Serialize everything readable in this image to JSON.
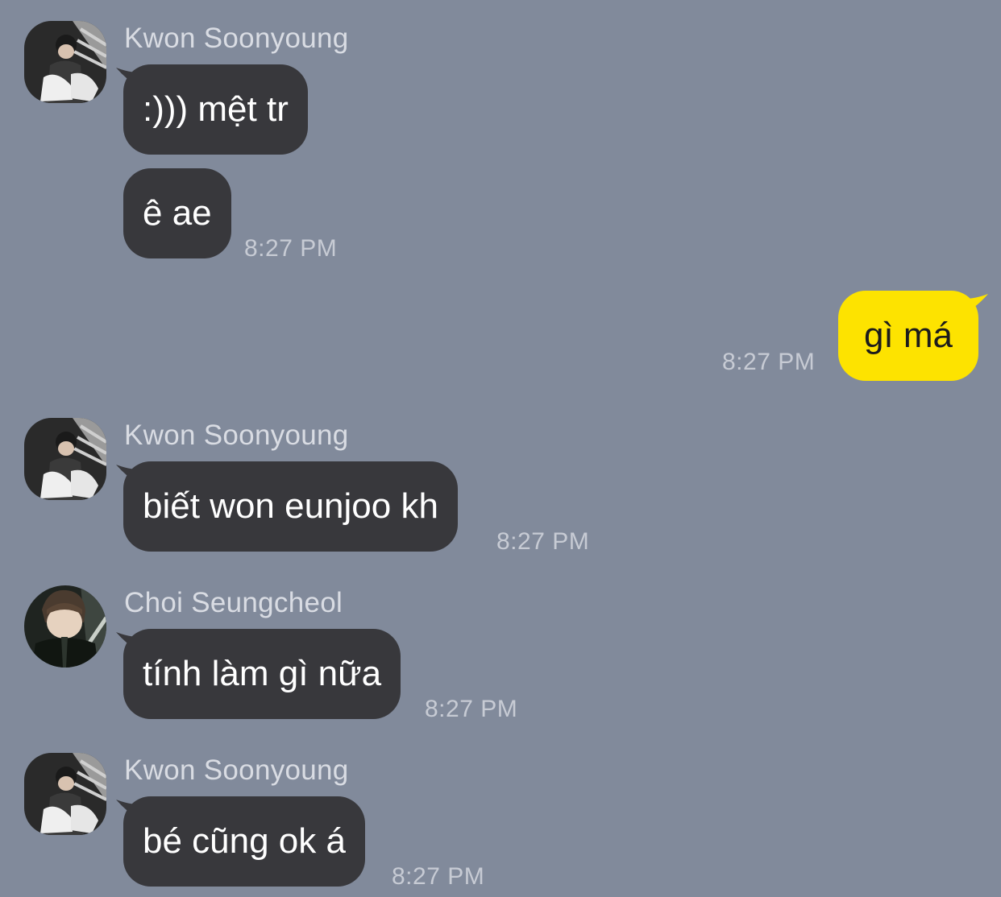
{
  "chat": {
    "colors": {
      "background": "#818a9b",
      "incoming_bubble": "#38383c",
      "outgoing_bubble": "#fde300"
    },
    "groups": [
      {
        "sender": "Kwon Soonyoung",
        "avatar": "kwon-soonyoung-avatar",
        "messages": [
          {
            "text": ":))) mệt tr"
          },
          {
            "text": "ê ae",
            "time": "8:27 PM"
          }
        ]
      },
      {
        "sender": "me",
        "messages": [
          {
            "text": "gì má",
            "time": "8:27 PM"
          }
        ]
      },
      {
        "sender": "Kwon Soonyoung",
        "avatar": "kwon-soonyoung-avatar",
        "messages": [
          {
            "text": "biết won eunjoo kh",
            "time": "8:27 PM"
          }
        ]
      },
      {
        "sender": "Choi Seungcheol",
        "avatar": "choi-seungcheol-avatar",
        "messages": [
          {
            "text": "tính làm gì nữa",
            "time": "8:27 PM"
          }
        ]
      },
      {
        "sender": "Kwon Soonyoung",
        "avatar": "kwon-soonyoung-avatar",
        "messages": [
          {
            "text": "bé cũng ok á",
            "time": "8:27 PM"
          }
        ]
      }
    ]
  }
}
